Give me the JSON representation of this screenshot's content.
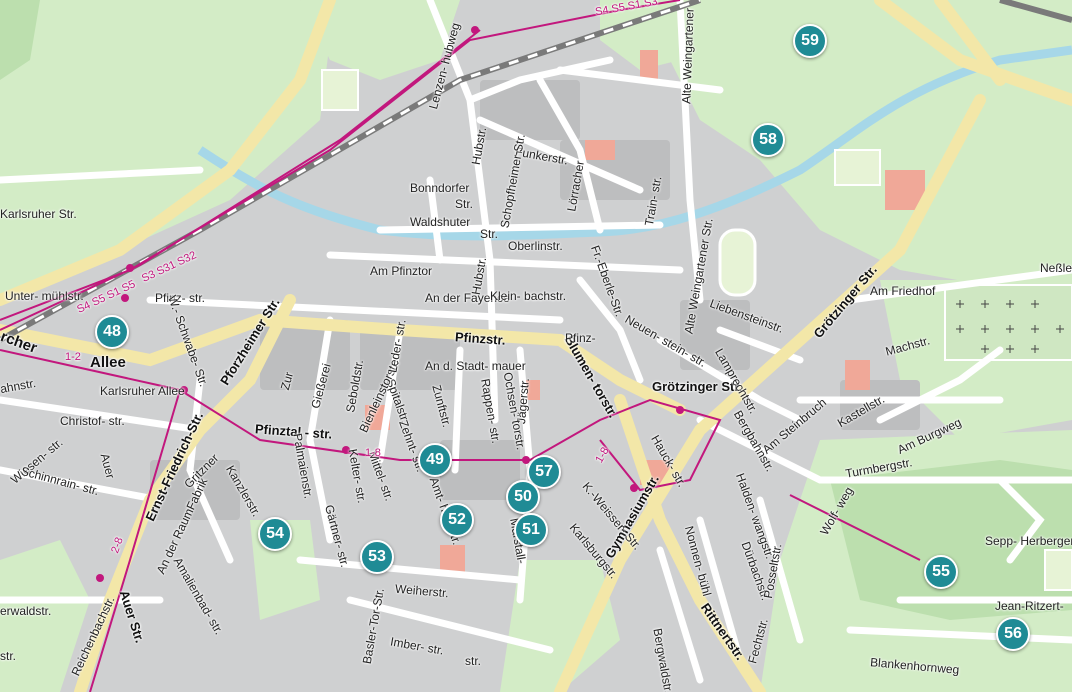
{
  "colors": {
    "park": "#d3ecc6",
    "forest": "#bcdfae",
    "road_major": "#f3e7a8",
    "road_minor": "#ffffff",
    "built": "#c9cacb",
    "rail_line": "#c2177d",
    "marker": "#1f8b95",
    "water": "#a6d7e8"
  },
  "markers": [
    {
      "id": "59",
      "label": "59"
    },
    {
      "id": "58",
      "label": "58"
    },
    {
      "id": "48",
      "label": "48"
    },
    {
      "id": "49",
      "label": "49"
    },
    {
      "id": "57",
      "label": "57"
    },
    {
      "id": "50",
      "label": "50"
    },
    {
      "id": "51",
      "label": "51"
    },
    {
      "id": "52",
      "label": "52"
    },
    {
      "id": "53",
      "label": "53"
    },
    {
      "id": "54",
      "label": "54"
    },
    {
      "id": "55",
      "label": "55"
    },
    {
      "id": "56",
      "label": "56"
    }
  ],
  "streets": {
    "allee": "Allee",
    "karlsruher_allee": "Karlsruher Allee",
    "pfinzstr": "Pfinzstr.",
    "pforzheimer_str": "Pforzheimer Str.",
    "pfinztal_str": "Pfinztal - str.",
    "ernst_friedrich_str": "Ernst-Friedrich-Str.",
    "auer_str": "Auer Str.",
    "blumentorstr": "Blumen- torstr.",
    "grotzinger_str": "Grötzinger Str.",
    "grotzinger_str2": "Grötzinger Str.",
    "gymnasiumstr": "Gymnasiumstr.",
    "rittnertstr": "Rittnertstr.",
    "funkerstr": "Funkerstr.",
    "waldshuter": "Waldshuter",
    "waldshuter_str": "Str.",
    "bonndorfer": "Bonndorfer",
    "bonndorfer_str": "Str.",
    "oberlinstr": "Oberlinstr.",
    "hubstr": "Hubstr.",
    "hubstr2": "Hubstr.",
    "schopfheimer": "Schopfheimer Str.",
    "lorracher": "Lörracher",
    "trainstr": "Train- str.",
    "alte_weingartener_top": "Alte Weingartener",
    "lenzenhubweg": "Lenzen- hubweg",
    "am_pfinztor": "Am Pfinztor",
    "an_der_fayence": "An der Fayence",
    "kleinbachstr": "Klein- bachstr.",
    "fr_eberle_str": "Fr.-Eberle-Str.",
    "alte_weingartener_str": "Alte Weingartener Str.",
    "liebensteinstr": "Liebensteinstr.",
    "neuensteinstr": "Neuen- stein- str.",
    "lamprechtstr": "Lamprechtstr.",
    "pfinzstr2": "Pfinz-",
    "pfinzstr3": "Pfinz- str.",
    "w_schwabe_str": "W.- Schwabe- Str.",
    "untermuhlstr": "Unter- mühlstr.",
    "karlsruher_str": "Karlsruher Str.",
    "neßle": "Neßle",
    "am_friedhof": "Am Friedhof",
    "machstr": "Machstr.",
    "kastellstr": "Kastellstr.",
    "am_burgweg": "Am Burgweg",
    "turmbergstr": "Turmbergstr.",
    "am_steinbruch": "Am Steinbruch",
    "bergbahnstr": "Bergbahnstr.",
    "wolfweg": "Wolf- weg",
    "sepp_herberger": "Sepp- Herberger",
    "jean_ritzert": "Jean-Ritzert-",
    "blankenhornweg": "Blankenhornweg",
    "haldenwangstr": "Halden- wangstr.",
    "durbachstr": "Dürbachstr.",
    "posseltstr": "Posseltstr.",
    "fechtstr": "Fechtstr.",
    "nonnenbuhl": "Nonnen- bühl",
    "bergwaldstr": "Bergwaldstr.",
    "karlsburgstr": "Karlsburgstr.",
    "k_weisser_str": "K.-Weisser- Str.",
    "hauckstr": "Hauck- str.",
    "marstall": "Marstall-",
    "jagerstr": "Jägerstr.",
    "ochsentorstr": "Ochsen- torstr.",
    "rappenstr": "Rappen- str.",
    "an_d_stadtmauer": "An d. Stadt- mauer",
    "zunftstr": "Zunftstr.",
    "spitalstr": "Spitalstr.",
    "zehntstr": "Zehnt- str.",
    "mittelstr": "Mittel- str.",
    "amthausstr": "Amt- hausstr.",
    "bienleinstorstr": "Bienleinstorstr.",
    "lederstr": "Leder- str.",
    "seboldstr": "Seboldstr.",
    "giesserei": "Gießerei",
    "zur": "Zur",
    "palmaienstr": "Palmaienstr.",
    "kelterstr": "Kelter- str.",
    "gartnerstr": "Gärtner- str.",
    "weiherstr": "Weiherstr.",
    "baslertorstr": "Basler-Tor-Str.",
    "imberstr": "Imber- str.",
    "kanzlerstr": "Kanzlerstr.",
    "amalienbadstr": "Amalienbad- str.",
    "an_der_raumfabrik": "An der RaumFabrik",
    "gritznerstr": "Gritzner",
    "christofstr": "Christof- str.",
    "wiesenstr": "Wiesen- str.",
    "schinnrainstr": "Schinnrain- str.",
    "auerstr_small": "Auer",
    "reichenbachstr": "Reichenbachstr.",
    "ahnstr": "ahnstr.",
    "erwaldstr": "erwaldstr.",
    "str_end": "str.",
    "dkarcher": "rcher",
    "turmbergstr_end": "str."
  },
  "rail_labels": {
    "s_top": "S4 S5 S1 S3",
    "s_mid": "S3 S31 S32",
    "s_low": "S4 S5 S1 S5",
    "t12": "1-2",
    "t18a": "1-8",
    "t18b": "1-8",
    "t28": "2-8"
  }
}
